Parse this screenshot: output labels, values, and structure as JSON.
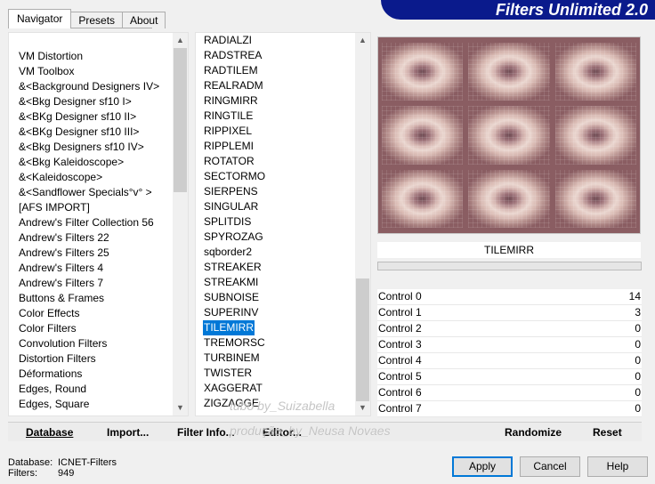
{
  "tabs": [
    {
      "label": "Navigator"
    },
    {
      "label": "Presets"
    },
    {
      "label": "About"
    }
  ],
  "banner": "Filters Unlimited 2.0",
  "categories": [
    "VM Distortion",
    "VM Toolbox",
    "&<Background Designers IV>",
    "&<Bkg Designer sf10 I>",
    "&<BKg Designer sf10 II>",
    "&<BKg Designer sf10 III>",
    "&<Bkg Designers sf10 IV>",
    "&<Bkg Kaleidoscope>",
    "&<Kaleidoscope>",
    "&<Sandflower Specials°v° >",
    "[AFS IMPORT]",
    "Andrew's Filter Collection 56",
    "Andrew's Filters 22",
    "Andrew's Filters 25",
    "Andrew's Filters 4",
    "Andrew's Filters 7",
    "Buttons & Frames",
    "Color Effects",
    "Color Filters",
    "Convolution Filters",
    "Distortion Filters",
    "Déformations",
    "Edges, Round",
    "Edges, Square"
  ],
  "filters": [
    "RADIALZI",
    "RADSTREA",
    "RADTILEM",
    "REALRADM",
    "RINGMIRR",
    "RINGTILE",
    "RIPPIXEL",
    "RIPPLEMI",
    "ROTATOR",
    "SECTORMO",
    "SIERPENS",
    "SINGULAR",
    "SPLITDIS",
    "SPYROZAG",
    "sqborder2",
    "STREAKER",
    "STREAKMI",
    "SUBNOISE",
    "SUPERINV",
    "TILEMIRR",
    "TREMORSC",
    "TURBINEM",
    "TWISTER",
    "XAGGERAT",
    "ZIGZAGGE"
  ],
  "selected_filter": "TILEMIRR",
  "controls": [
    {
      "label": "Control 0",
      "value": "14"
    },
    {
      "label": "Control 1",
      "value": "3"
    },
    {
      "label": "Control 2",
      "value": "0"
    },
    {
      "label": "Control 3",
      "value": "0"
    },
    {
      "label": "Control 4",
      "value": "0"
    },
    {
      "label": "Control 5",
      "value": "0"
    },
    {
      "label": "Control 6",
      "value": "0"
    },
    {
      "label": "Control 7",
      "value": "0"
    }
  ],
  "toolbar": {
    "database": "Database",
    "import": "Import...",
    "filter_info": "Filter Info...",
    "editor": "Editor...",
    "randomize": "Randomize",
    "reset": "Reset"
  },
  "watermark": {
    "line1": "tubo by_Suizabella",
    "line2": "produção_by_Neusa Novaes"
  },
  "status": {
    "database_label": "Database:",
    "database_value": "ICNET-Filters",
    "filters_label": "Filters:",
    "filters_value": "949"
  },
  "buttons": {
    "apply": "Apply",
    "cancel": "Cancel",
    "help": "Help"
  },
  "icons": {
    "scroll_up": "chevron-up-icon",
    "scroll_down": "chevron-down-icon"
  }
}
